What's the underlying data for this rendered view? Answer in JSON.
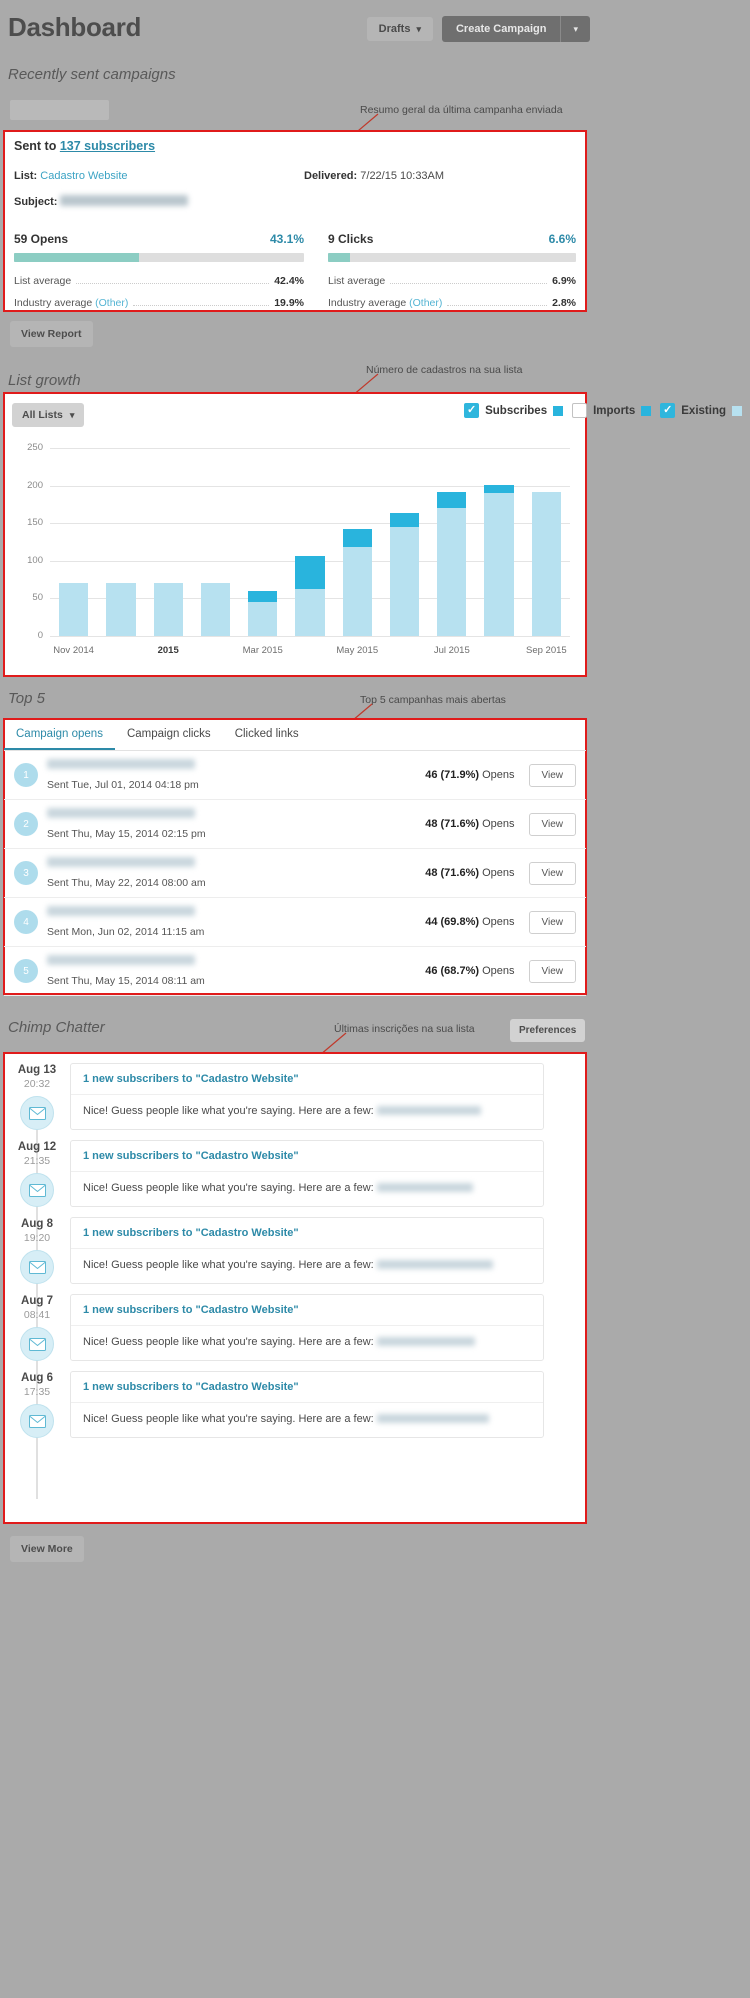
{
  "header": {
    "title": "Dashboard",
    "drafts_label": "Drafts",
    "create_label": "Create Campaign",
    "caret": "⌄"
  },
  "annotations": [
    {
      "text": "Resumo geral da última campanha enviada"
    },
    {
      "text": "Número de cadastros na sua lista"
    },
    {
      "text": "Top 5 campanhas mais abertas"
    },
    {
      "text": "Últimas inscrições na sua lista"
    }
  ],
  "recently_sent": {
    "section_title": "Recently sent campaigns",
    "filter_chip": "",
    "sent_to_prefix": "Sent to",
    "sent_to_link": "137 subscribers",
    "list_label": "List:",
    "list_value": "Cadastro Website",
    "delivered_label": "Delivered:",
    "delivered_value": "7/22/15 10:33AM",
    "subject_label": "Subject:",
    "subject_value": "",
    "opens": {
      "label": "59 Opens",
      "pct": "43.1%",
      "bar_pct": 43.1,
      "list_average_label": "List average",
      "list_average_value": "42.4%",
      "industry_label": "Industry average",
      "industry_link": "(Other)",
      "industry_value": "19.9%"
    },
    "clicks": {
      "label": "9 Clicks",
      "pct": "6.6%",
      "bar_pct": 9.0,
      "list_average_label": "List average",
      "list_average_value": "6.9%",
      "industry_label": "Industry average",
      "industry_link": "(Other)",
      "industry_value": "2.8%"
    },
    "view_report_label": "View Report"
  },
  "list_growth": {
    "section_title": "List growth",
    "all_lists_label": "All Lists",
    "legend": [
      {
        "label": "Subscribes",
        "checked": true,
        "color": "#29b4dd"
      },
      {
        "label": "Imports",
        "checked": false,
        "color": "#29b4dd"
      },
      {
        "label": "Existing",
        "checked": true,
        "color": "#b7e1f0"
      }
    ]
  },
  "chart_data": {
    "type": "bar",
    "title": "List growth",
    "xlabel": "",
    "ylabel": "",
    "ylim": [
      0,
      250
    ],
    "yticks": [
      0,
      50,
      100,
      150,
      200,
      250
    ],
    "grid": true,
    "legend_position": "top-right",
    "stacked": true,
    "categories": [
      "Nov 2014",
      "Dec 2014",
      "2015",
      "Feb 2015",
      "Mar 2015",
      "Apr 2015",
      "May 2015",
      "Jun 2015",
      "Jul 2015",
      "Aug 2015",
      "Sep 2015"
    ],
    "tick_labels": [
      "Nov 2014",
      "2015",
      "Mar 2015",
      "May 2015",
      "Jul 2015",
      "Sep 2015"
    ],
    "tick_label_indices": [
      0,
      2,
      4,
      6,
      8,
      10
    ],
    "series": [
      {
        "name": "Existing",
        "color": "#b7e1f0",
        "values": [
          70,
          70,
          70,
          71,
          45,
          62,
          118,
          145,
          170,
          190,
          192
        ]
      },
      {
        "name": "Subscribes",
        "color": "#29b4dd",
        "values": [
          0,
          0,
          0,
          0,
          15,
          45,
          24,
          18,
          22,
          11,
          0
        ]
      }
    ],
    "totals": [
      70,
      70,
      70,
      71,
      60,
      107,
      142,
      163,
      192,
      201,
      192
    ]
  },
  "top5": {
    "section_title": "Top 5",
    "tabs": [
      {
        "label": "Campaign opens",
        "active": true
      },
      {
        "label": "Campaign clicks",
        "active": false
      },
      {
        "label": "Clicked links",
        "active": false
      }
    ],
    "view_label": "View",
    "rows": [
      {
        "num": "1",
        "title": "",
        "date": "Sent Tue, Jul 01, 2014 04:18 pm",
        "stat": "46 (71.9%)",
        "stat_suffix": "Opens"
      },
      {
        "num": "2",
        "title": "",
        "date": "Sent Thu, May 15, 2014 02:15 pm",
        "stat": "48 (71.6%)",
        "stat_suffix": "Opens"
      },
      {
        "num": "3",
        "title": "",
        "date": "Sent Thu, May 22, 2014 08:00 am",
        "stat": "48 (71.6%)",
        "stat_suffix": "Opens"
      },
      {
        "num": "4",
        "title": "",
        "date": "Sent Mon, Jun 02, 2014 11:15 am",
        "stat": "44 (69.8%)",
        "stat_suffix": "Opens"
      },
      {
        "num": "5",
        "title": "",
        "date": "Sent Thu, May 15, 2014 08:11 am",
        "stat": "46 (68.7%)",
        "stat_suffix": "Opens"
      }
    ]
  },
  "chimp_chatter": {
    "section_title": "Chimp Chatter",
    "preferences_label": "Preferences",
    "view_more_label": "View More",
    "items": [
      {
        "date": "Aug 13",
        "time": "20:32",
        "headline": "1 new subscribers to \"Cadastro Website\"",
        "text": "Nice! Guess people like what you're saying. Here are a few:",
        "redacted": ""
      },
      {
        "date": "Aug 12",
        "time": "21:35",
        "headline": "1 new subscribers to \"Cadastro Website\"",
        "text": "Nice! Guess people like what you're saying. Here are a few:",
        "redacted": ""
      },
      {
        "date": "Aug 8",
        "time": "19:20",
        "headline": "1 new subscribers to \"Cadastro Website\"",
        "text": "Nice! Guess people like what you're saying. Here are a few:",
        "redacted": ""
      },
      {
        "date": "Aug 7",
        "time": "08:41",
        "headline": "1 new subscribers to \"Cadastro Website\"",
        "text": "Nice! Guess people like what you're saying. Here are a few:",
        "redacted": ""
      },
      {
        "date": "Aug 6",
        "time": "17:35",
        "headline": "1 new subscribers to \"Cadastro Website\"",
        "text": "Nice! Guess people like what you're saying. Here are a few:",
        "redacted": ""
      }
    ]
  }
}
